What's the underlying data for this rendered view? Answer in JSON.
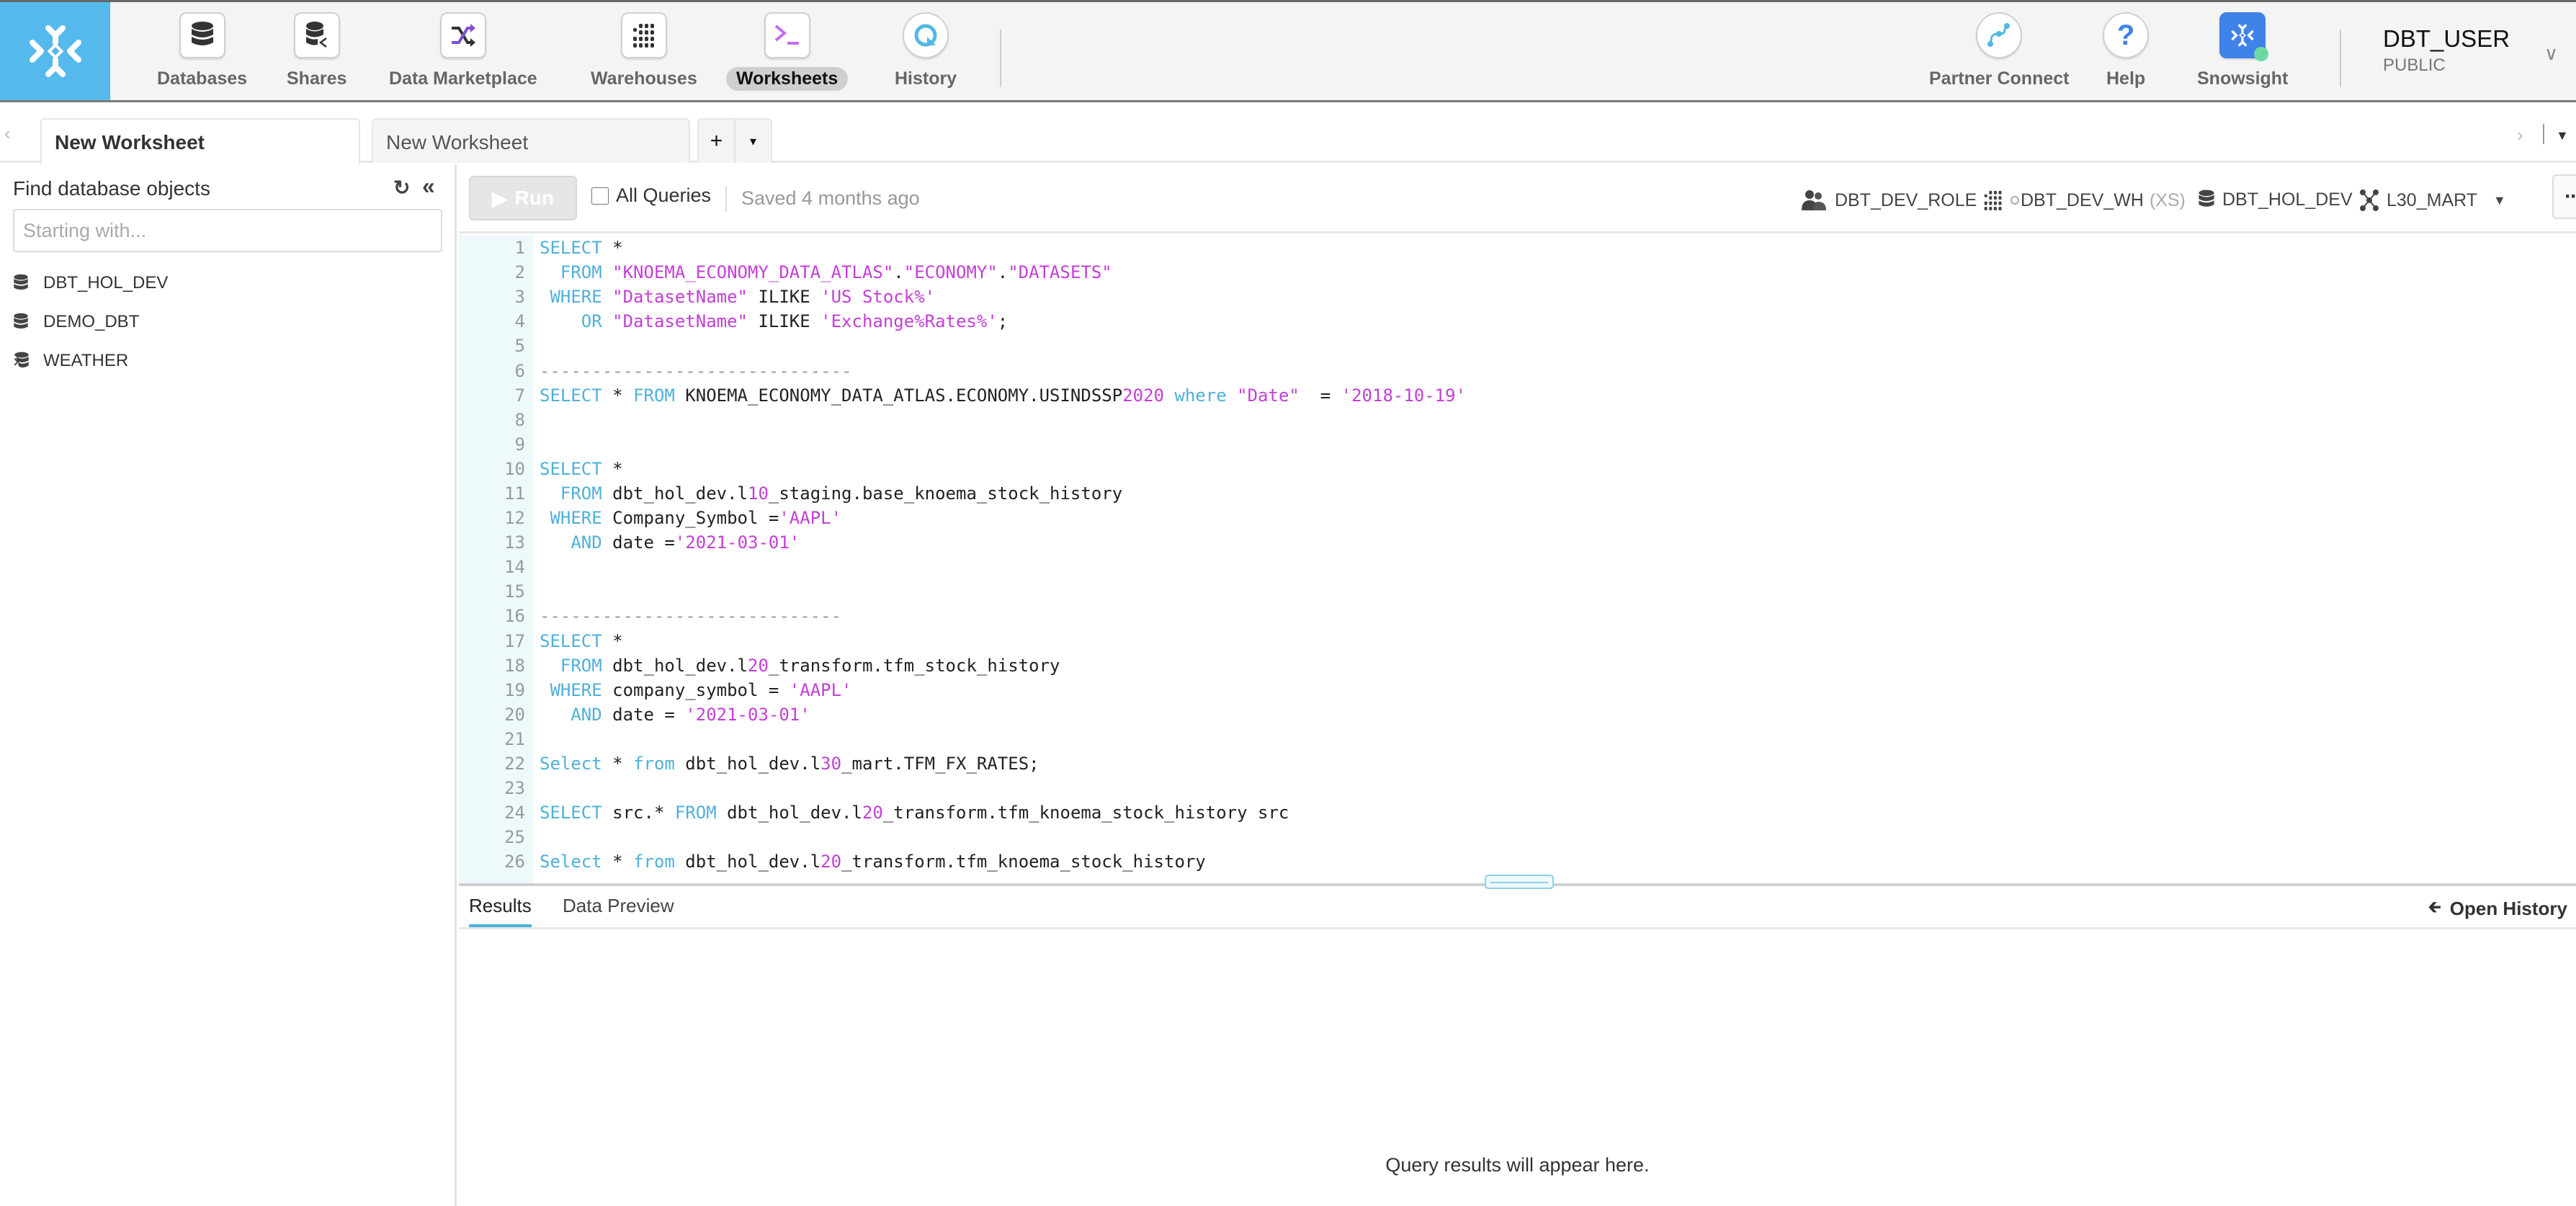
{
  "nav": {
    "logo_icon": "snowflake-logo",
    "items": [
      {
        "label": "Databases",
        "icon": "database-icon",
        "active": false
      },
      {
        "label": "Shares",
        "icon": "shares-icon",
        "active": false
      },
      {
        "label": "Data Marketplace",
        "icon": "marketplace-shuffle-icon",
        "active": false
      },
      {
        "label": "Warehouses",
        "icon": "warehouse-grid-icon",
        "active": false
      },
      {
        "label": "Worksheets",
        "icon": "terminal-icon",
        "active": true
      },
      {
        "label": "History",
        "icon": "history-icon",
        "active": false
      }
    ],
    "right_items": [
      {
        "label": "Partner Connect",
        "icon": "partner-connect-icon"
      },
      {
        "label": "Help",
        "icon": "help-icon"
      },
      {
        "label": "Snowsight",
        "icon": "snowsight-icon"
      }
    ],
    "user": {
      "name": "DBT_USER",
      "role": "PUBLIC"
    }
  },
  "tabs": {
    "items": [
      {
        "label": "New Worksheet",
        "active": true
      },
      {
        "label": "New Worksheet",
        "active": false
      }
    ],
    "add_label": "+",
    "menu_label": "▾"
  },
  "left_panel": {
    "title": "Find database objects",
    "search_placeholder": "Starting with...",
    "databases": [
      {
        "name": "DBT_HOL_DEV",
        "icon": "database-icon"
      },
      {
        "name": "DEMO_DBT",
        "icon": "database-icon"
      },
      {
        "name": "WEATHER",
        "icon": "shared-database-icon"
      }
    ]
  },
  "toolbar": {
    "run_label": "Run",
    "all_queries_label": "All Queries",
    "all_queries_checked": false,
    "saved_status": "Saved 4 months ago",
    "context": {
      "role": "DBT_DEV_ROLE",
      "warehouse": "DBT_DEV_WH",
      "warehouse_size": "(XS)",
      "database": "DBT_HOL_DEV",
      "schema": "L30_MART"
    },
    "more_label": "···"
  },
  "editor": {
    "lines": [
      [
        [
          "k",
          "SELECT"
        ],
        [
          "t",
          " *"
        ]
      ],
      [
        [
          "t",
          "  "
        ],
        [
          "k",
          "FROM"
        ],
        [
          "t",
          " "
        ],
        [
          "s",
          "\"KNOEMA_ECONOMY_DATA_ATLAS\""
        ],
        [
          "t",
          "."
        ],
        [
          "s",
          "\"ECONOMY\""
        ],
        [
          "t",
          "."
        ],
        [
          "s",
          "\"DATASETS\""
        ]
      ],
      [
        [
          "t",
          " "
        ],
        [
          "k",
          "WHERE"
        ],
        [
          "t",
          " "
        ],
        [
          "s",
          "\"DatasetName\""
        ],
        [
          "t",
          " ILIKE "
        ],
        [
          "s",
          "'US Stock%'"
        ]
      ],
      [
        [
          "t",
          "    "
        ],
        [
          "k",
          "OR"
        ],
        [
          "t",
          " "
        ],
        [
          "s",
          "\"DatasetName\""
        ],
        [
          "t",
          " ILIKE "
        ],
        [
          "s",
          "'Exchange%Rates%'"
        ],
        [
          "t",
          ";"
        ]
      ],
      [],
      [
        [
          "c",
          "------------------------------"
        ]
      ],
      [
        [
          "k",
          "SELECT"
        ],
        [
          "t",
          " * "
        ],
        [
          "k",
          "FROM"
        ],
        [
          "t",
          " KNOEMA_ECONOMY_DATA_ATLAS.ECONOMY.USINDSSP"
        ],
        [
          "n",
          "2020"
        ],
        [
          "t",
          " "
        ],
        [
          "k",
          "where"
        ],
        [
          "t",
          " "
        ],
        [
          "s",
          "\"Date\""
        ],
        [
          "t",
          "  = "
        ],
        [
          "s",
          "'2018-10-19'"
        ]
      ],
      [],
      [],
      [
        [
          "k",
          "SELECT"
        ],
        [
          "t",
          " *"
        ]
      ],
      [
        [
          "t",
          "  "
        ],
        [
          "k",
          "FROM"
        ],
        [
          "t",
          " dbt_hol_dev.l"
        ],
        [
          "n",
          "10"
        ],
        [
          "t",
          "_staging.base_knoema_stock_history"
        ]
      ],
      [
        [
          "t",
          " "
        ],
        [
          "k",
          "WHERE"
        ],
        [
          "t",
          " Company_Symbol ="
        ],
        [
          "s",
          "'AAPL'"
        ]
      ],
      [
        [
          "t",
          "   "
        ],
        [
          "k",
          "AND"
        ],
        [
          "t",
          " date ="
        ],
        [
          "s",
          "'2021-03-01'"
        ]
      ],
      [],
      [],
      [
        [
          "c",
          "-----------------------------"
        ]
      ],
      [
        [
          "k",
          "SELECT"
        ],
        [
          "t",
          " *"
        ]
      ],
      [
        [
          "t",
          "  "
        ],
        [
          "k",
          "FROM"
        ],
        [
          "t",
          " dbt_hol_dev.l"
        ],
        [
          "n",
          "20"
        ],
        [
          "t",
          "_transform.tfm_stock_history"
        ]
      ],
      [
        [
          "t",
          " "
        ],
        [
          "k",
          "WHERE"
        ],
        [
          "t",
          " company_symbol = "
        ],
        [
          "s",
          "'AAPL'"
        ]
      ],
      [
        [
          "t",
          "   "
        ],
        [
          "k",
          "AND"
        ],
        [
          "t",
          " date = "
        ],
        [
          "s",
          "'2021-03-01'"
        ]
      ],
      [],
      [
        [
          "k",
          "Select"
        ],
        [
          "t",
          " * "
        ],
        [
          "k",
          "from"
        ],
        [
          "t",
          " dbt_hol_dev.l"
        ],
        [
          "n",
          "30"
        ],
        [
          "t",
          "_mart.TFM_FX_RATES;"
        ]
      ],
      [],
      [
        [
          "k",
          "SELECT"
        ],
        [
          "t",
          " src.* "
        ],
        [
          "k",
          "FROM"
        ],
        [
          "t",
          " dbt_hol_dev.l"
        ],
        [
          "n",
          "20"
        ],
        [
          "t",
          "_transform.tfm_knoema_stock_history src"
        ]
      ],
      [],
      [
        [
          "k",
          "Select"
        ],
        [
          "t",
          " * "
        ],
        [
          "k",
          "from"
        ],
        [
          "t",
          " dbt_hol_dev.l"
        ],
        [
          "n",
          "20"
        ],
        [
          "t",
          "_transform.tfm_knoema_stock_history"
        ]
      ]
    ]
  },
  "results": {
    "tabs": [
      {
        "label": "Results",
        "active": true
      },
      {
        "label": "Data Preview",
        "active": false
      }
    ],
    "open_history_label": "Open History",
    "empty_message": "Query results will appear here."
  },
  "colors": {
    "brand_blue": "#56b9eb",
    "keyword": "#4fb0d9",
    "string": "#c33fd6",
    "snowsight_blue": "#3f82e8",
    "status_green": "#6cd9a3"
  }
}
